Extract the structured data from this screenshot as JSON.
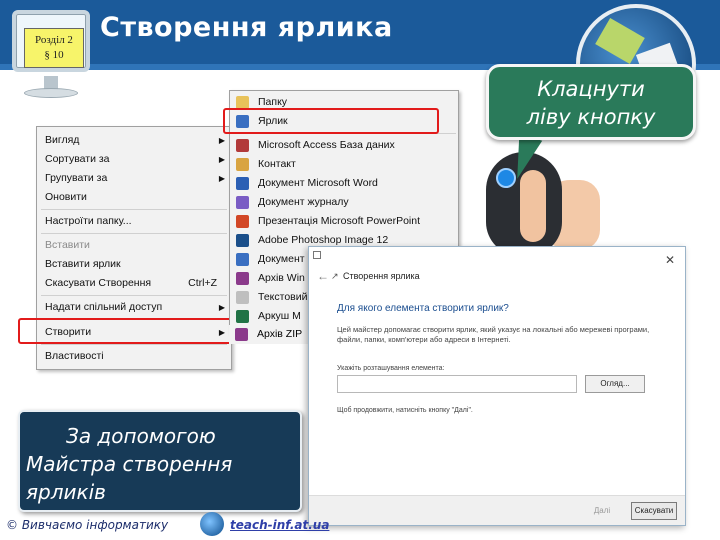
{
  "header": {
    "section_line1": "Розділ 2",
    "section_line2": "§ 10",
    "title": "Створення ярлика"
  },
  "callout": {
    "line1": "Клацнути",
    "line2": "ліву кнопку"
  },
  "context_menu": {
    "items": [
      {
        "label": "Вигляд",
        "arrow": "▶"
      },
      {
        "label": "Сортувати за",
        "arrow": "▶"
      },
      {
        "label": "Групувати за",
        "arrow": "▶"
      },
      {
        "label": "Оновити"
      },
      {
        "label": "Настроїти папку..."
      },
      {
        "label": "Вставити",
        "disabled": true
      },
      {
        "label": "Вставити ярлик"
      },
      {
        "label": "Скасувати Створення",
        "shortcut": "Ctrl+Z"
      },
      {
        "label": "Надати спільний доступ",
        "arrow": "▶"
      },
      {
        "label": "Створити",
        "arrow": "▶"
      },
      {
        "label": "Властивості"
      }
    ]
  },
  "submenu": {
    "items": [
      {
        "label": "Папку",
        "icon": "folder-icon",
        "color": "#e8c25a"
      },
      {
        "label": "Ярлик",
        "icon": "shortcut-icon",
        "color": "#3a6fc1"
      },
      {
        "label": "Microsoft Access База даних",
        "icon": "access-icon",
        "color": "#b23a3a"
      },
      {
        "label": "Контакт",
        "icon": "contact-icon",
        "color": "#d9a441"
      },
      {
        "label": "Документ Microsoft Word",
        "icon": "word-icon",
        "color": "#2b5fb4"
      },
      {
        "label": "Документ журналу",
        "icon": "journal-icon",
        "color": "#7a5cc4"
      },
      {
        "label": "Презентація Microsoft PowerPoint",
        "icon": "powerpoint-icon",
        "color": "#d24726"
      },
      {
        "label": "Adobe Photoshop Image 12",
        "icon": "photoshop-icon",
        "color": "#1b4f8a"
      },
      {
        "label": "Документ",
        "icon": "document-icon",
        "color": "#3a6fc1"
      },
      {
        "label": "Архів Win",
        "icon": "archive-icon",
        "color": "#8b3a8b"
      },
      {
        "label": "Текстовий",
        "icon": "text-icon",
        "color": "#bfbfbf"
      },
      {
        "label": "Аркуш M",
        "icon": "excel-icon",
        "color": "#217346"
      },
      {
        "label": "Архів ZIP",
        "icon": "zip-icon",
        "color": "#8b3a8b"
      }
    ]
  },
  "dialog": {
    "title": "Створення ярлика",
    "close": "✕",
    "heading": "Для якого елемента створити ярлик?",
    "description": "Цей майстер допомагає створити ярлик, який указує на локальні або мережеві програми, файли, папки, комп'ютери або адреси в Інтернеті.",
    "location_label": "Укажіть розташування елемента:",
    "browse_label": "Огляд...",
    "hint": "Щоб продовжити, натисніть кнопку \"Далі\".",
    "next_label": "Далі",
    "cancel_label": "Скасувати"
  },
  "wizard_label": {
    "line1": "За допомогою",
    "line2": "Майстра створення",
    "line3": "ярликів"
  },
  "footer": {
    "copyright": "© Вивчаємо інформатику",
    "site": "teach-inf.at.ua"
  }
}
